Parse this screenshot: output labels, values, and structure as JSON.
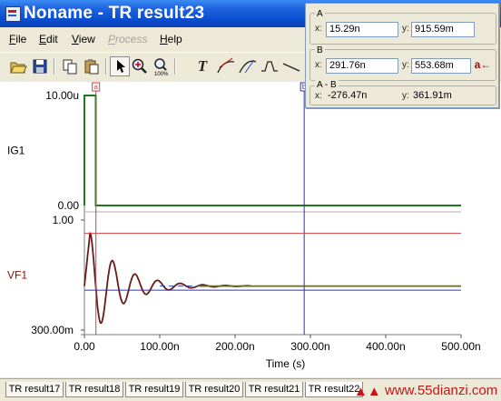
{
  "window": {
    "title": "Noname - TR result23"
  },
  "menu": {
    "file": {
      "acc": "F",
      "rest": "ile"
    },
    "edit": {
      "acc": "E",
      "rest": "dit"
    },
    "view": {
      "acc": "V",
      "rest": "iew"
    },
    "process": {
      "acc": "P",
      "rest": "rocess"
    },
    "help": {
      "acc": "H",
      "rest": "elp"
    }
  },
  "toolbar": {
    "open_icon": "folder-open-icon",
    "save_icon": "save-icon",
    "copy_icon": "copy-icon",
    "paste_icon": "paste-icon",
    "pointer_icon": "pointer-icon",
    "zoom_in_icon": "zoom-in-icon",
    "zoom_fit_icon": "zoom-fit-icon",
    "text_icon": "text-icon",
    "text_label": "T",
    "curve_tools": [
      "tangent-icon",
      "slope-icon",
      "waveform-icon",
      "line-icon"
    ]
  },
  "cursor_panel": {
    "a": {
      "heading": "A",
      "x_label": "x:",
      "x_value": "15.29n",
      "y_label": "y:",
      "y_value": "915.59m"
    },
    "b": {
      "heading": "B",
      "x_label": "x:",
      "x_value": "291.76n",
      "y_label": "y:",
      "y_value": "553.68m"
    },
    "ab": {
      "heading": "A - B",
      "x_label": "x:",
      "x_value": "-276.47n",
      "y_label": "y:",
      "y_value": "361.91m"
    },
    "swap_label": "a←"
  },
  "chart_data": {
    "type": "line",
    "xlabel": "Time (s)",
    "x_ticks": [
      "0.00",
      "100.00n",
      "200.00n",
      "300.00n",
      "400.00n",
      "500.00n"
    ],
    "xlim": [
      0,
      500
    ],
    "cursors": {
      "a_x": 15.29,
      "b_x": 291.76,
      "a_label": "a",
      "b_label": "b"
    },
    "plots": [
      {
        "name": "IG1",
        "ylim_labels": [
          "10.00u",
          "0.00"
        ],
        "ylim": [
          0,
          10
        ],
        "series": [
          {
            "color": "#1f7a1f",
            "x": [
              0,
              0,
              15,
              15,
              500
            ],
            "y": [
              0,
              10,
              10,
              0,
              0
            ]
          }
        ]
      },
      {
        "name": "VF1",
        "ylim_labels": [
          "1.00",
          "300.00m"
        ],
        "ylim": [
          0.3,
          1.0
        ],
        "cursor_a_y": 0.91559,
        "cursor_b_y": 0.55368,
        "series": [
          {
            "color": "#6b1a1a",
            "final": 0.58,
            "amp": 0.34,
            "tau": 40,
            "period": 30,
            "phase_t": 7.5,
            "until": 220
          },
          {
            "color": "#6a6a2a",
            "final": 0.58,
            "amp": 0.0,
            "from": 150
          }
        ]
      }
    ]
  },
  "tabs": [
    {
      "label": "TR result17",
      "active": false
    },
    {
      "label": "TR result18",
      "active": false
    },
    {
      "label": "TR result19",
      "active": false
    },
    {
      "label": "TR result20",
      "active": false
    },
    {
      "label": "TR result21",
      "active": false
    },
    {
      "label": "TR result22",
      "active": true
    }
  ],
  "watermark": {
    "text": "www.55dianzi.com"
  },
  "colors": {
    "title_bar": "#0a4fd0",
    "trace_green": "#1f7a1f",
    "trace_red": "#7a1010",
    "cursor_red": "#d04040",
    "cursor_blue": "#3030c0"
  }
}
